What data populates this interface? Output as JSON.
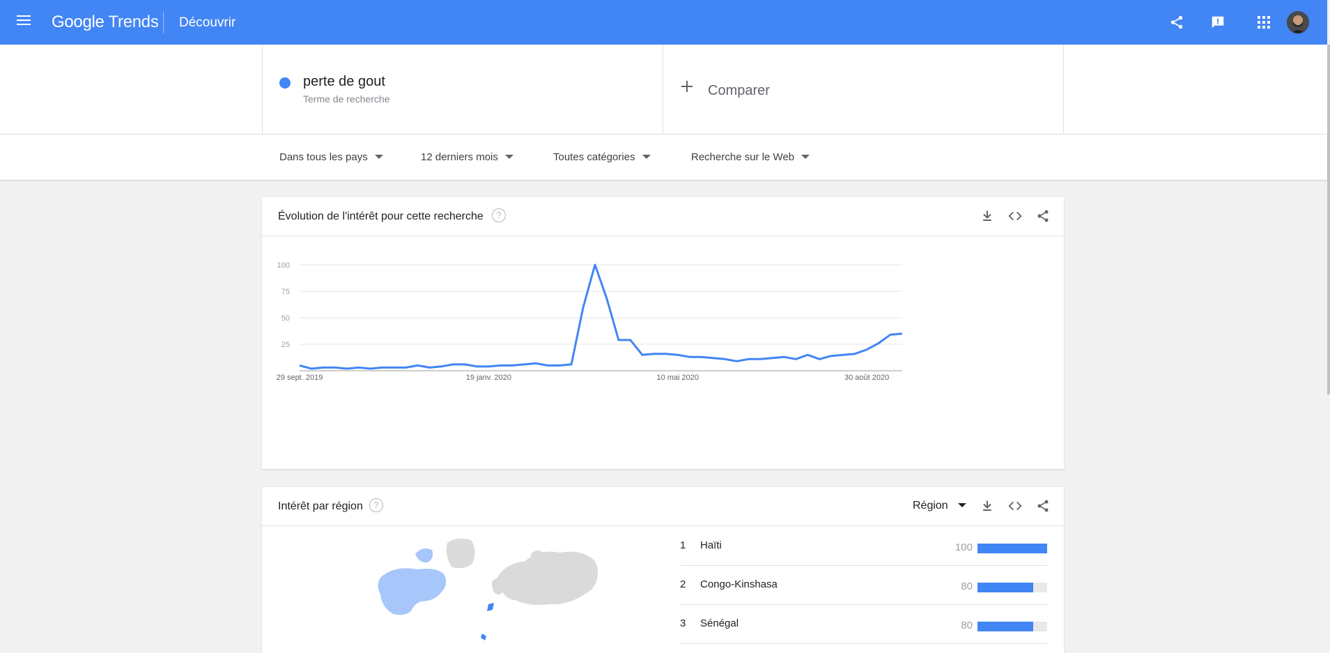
{
  "header": {
    "logo_google": "Google",
    "logo_trends": "Trends",
    "page_label": "Découvrir",
    "icons": [
      "share-icon",
      "feedback-icon",
      "apps-icon"
    ],
    "brand_color": "#4285f4"
  },
  "search": {
    "term": "perte de gout",
    "term_type": "Terme de recherche",
    "term_color": "#4285f4",
    "compare_label": "Comparer"
  },
  "filters": {
    "region": "Dans tous les pays",
    "period": "12 derniers mois",
    "category": "Toutes catégories",
    "property": "Recherche sur le Web"
  },
  "interest_over_time": {
    "title": "Évolution de l'intérêt pour cette recherche",
    "help": "?"
  },
  "chart_data": {
    "type": "line",
    "title": "Évolution de l'intérêt pour cette recherche",
    "xlabel": "",
    "ylabel": "",
    "ylim": [
      0,
      100
    ],
    "y_ticks": [
      "100",
      "75",
      "50",
      "25"
    ],
    "x_tick_labels": [
      "29 sept. 2019",
      "19 janv. 2020",
      "10 mai 2020",
      "30 août 2020"
    ],
    "x_tick_index": [
      0,
      16,
      32,
      48
    ],
    "grid": true,
    "legend": "none",
    "series": [
      {
        "color": "#4285f4",
        "values": [
          5,
          2,
          3,
          3,
          2,
          3,
          2,
          3,
          3,
          3,
          5,
          3,
          4,
          6,
          6,
          4,
          4,
          5,
          5,
          6,
          7,
          5,
          5,
          6,
          60,
          100,
          68,
          29,
          29,
          15,
          16,
          16,
          15,
          13,
          13,
          12,
          11,
          9,
          11,
          11,
          12,
          13,
          11,
          15,
          11,
          14,
          15,
          16,
          20,
          26,
          34,
          35
        ]
      }
    ]
  },
  "interest_by_region": {
    "title": "Intérêt par région",
    "help": "?",
    "resolution": "Région",
    "rows": [
      {
        "rank": "1",
        "name": "Haïti",
        "value": "100",
        "pct": 100
      },
      {
        "rank": "2",
        "name": "Congo-Kinshasa",
        "value": "80",
        "pct": 80
      },
      {
        "rank": "3",
        "name": "Sénégal",
        "value": "80",
        "pct": 80
      }
    ]
  }
}
